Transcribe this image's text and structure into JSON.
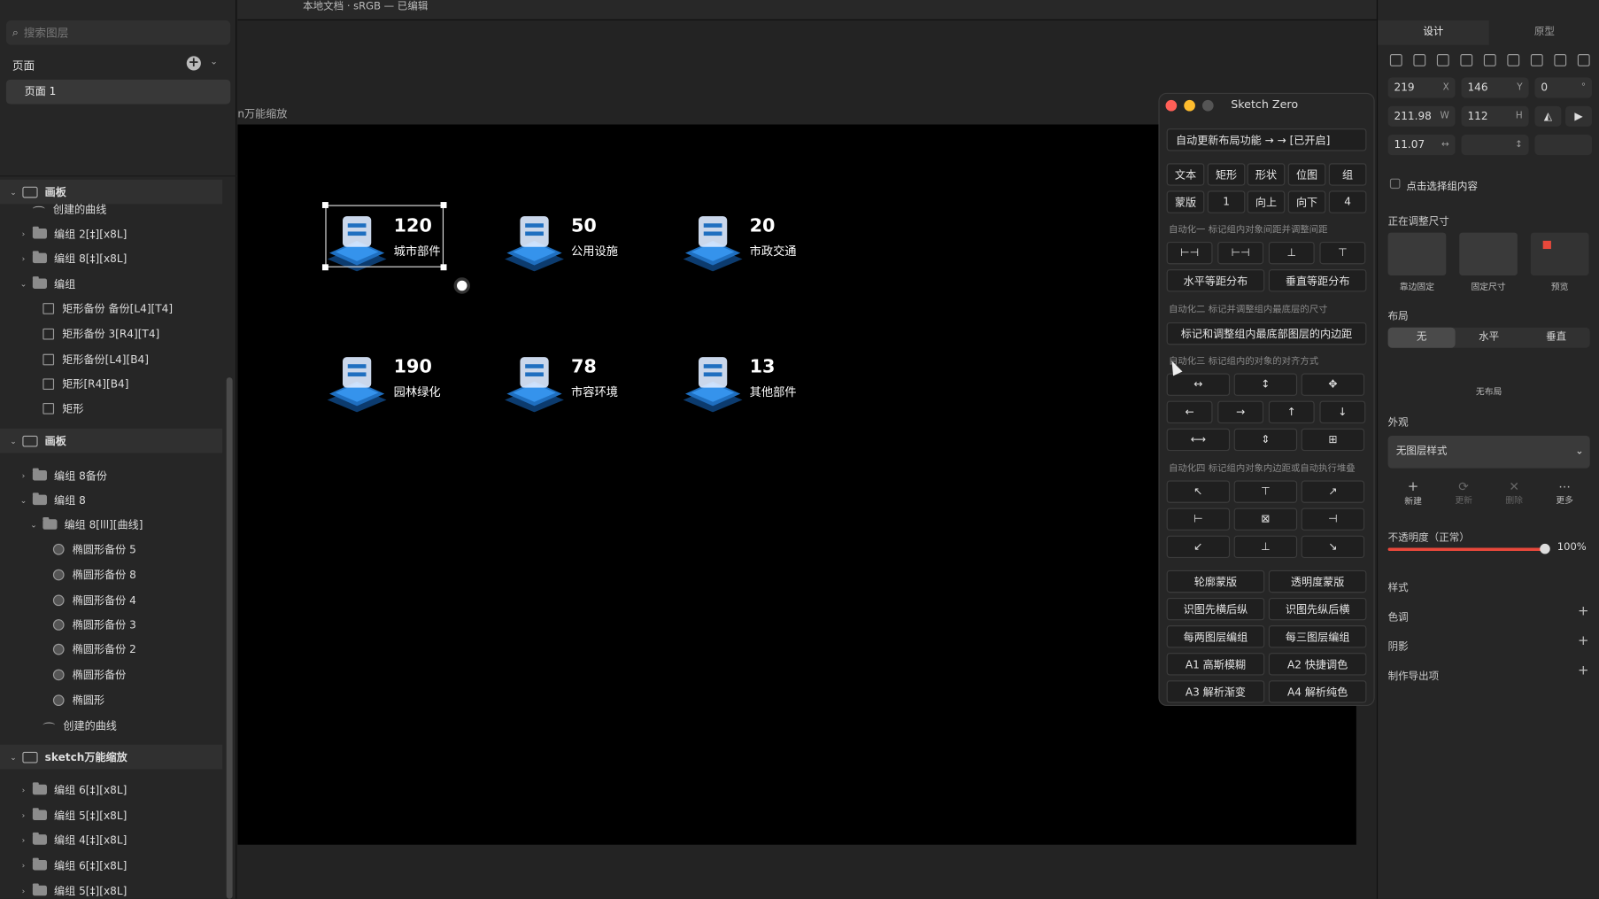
{
  "topbar": {
    "title": "本地文档 · sRGB — 已编辑"
  },
  "left": {
    "search_placeholder": "搜索图层",
    "pages_label": "页面",
    "page_item": "页面 1",
    "layers": [
      {
        "depth": 0,
        "kind": "board",
        "text": "画板",
        "open": true
      },
      {
        "depth": 1,
        "kind": "curve",
        "text": "创建的曲线"
      },
      {
        "depth": 1,
        "kind": "folder",
        "text": "编组 2[‡][x8L]",
        "open": false
      },
      {
        "depth": 1,
        "kind": "folder",
        "text": "编组 8[‡][x8L]",
        "open": false
      },
      {
        "depth": 1,
        "kind": "folder",
        "text": "编组",
        "open": true
      },
      {
        "depth": 2,
        "kind": "rect",
        "text": "矩形备份 备份[L4][T4]"
      },
      {
        "depth": 2,
        "kind": "rect",
        "text": "矩形备份 3[R4][T4]"
      },
      {
        "depth": 2,
        "kind": "rect",
        "text": "矩形备份[L4][B4]"
      },
      {
        "depth": 2,
        "kind": "rect",
        "text": "矩形[R4][B4]"
      },
      {
        "depth": 2,
        "kind": "rect",
        "text": "矩形"
      },
      {
        "depth": 0,
        "kind": "board",
        "text": "画板",
        "open": true
      },
      {
        "depth": 1,
        "kind": "folder",
        "text": "编组 8备份",
        "open": false
      },
      {
        "depth": 1,
        "kind": "folder",
        "text": "编组 8",
        "open": true
      },
      {
        "depth": 2,
        "kind": "folder",
        "text": "编组 8[lll][曲线]",
        "open": true
      },
      {
        "depth": 3,
        "kind": "circle",
        "text": "椭圆形备份 5"
      },
      {
        "depth": 3,
        "kind": "circle",
        "text": "椭圆形备份 8"
      },
      {
        "depth": 3,
        "kind": "circle",
        "text": "椭圆形备份 4"
      },
      {
        "depth": 3,
        "kind": "circle",
        "text": "椭圆形备份 3"
      },
      {
        "depth": 3,
        "kind": "circle",
        "text": "椭圆形备份 2"
      },
      {
        "depth": 3,
        "kind": "circle",
        "text": "椭圆形备份"
      },
      {
        "depth": 3,
        "kind": "circle",
        "text": "椭圆形"
      },
      {
        "depth": 2,
        "kind": "curve",
        "text": "创建的曲线"
      },
      {
        "depth": 0,
        "kind": "board",
        "text": "sketch万能缩放",
        "open": true
      },
      {
        "depth": 1,
        "kind": "folder",
        "text": "编组 6[‡][x8L]",
        "open": false
      },
      {
        "depth": 1,
        "kind": "folder",
        "text": "编组 5[‡][x8L]",
        "open": false
      },
      {
        "depth": 1,
        "kind": "folder",
        "text": "编组 4[‡][x8L]",
        "open": false
      },
      {
        "depth": 1,
        "kind": "folder",
        "text": "编组 6[‡][x8L]",
        "open": false
      },
      {
        "depth": 1,
        "kind": "folder",
        "text": "编组 5[‡][x8L]",
        "open": false
      }
    ]
  },
  "canvas": {
    "artboard_label": "n万能缩放",
    "tiles": [
      {
        "value": "120",
        "label": "城市部件",
        "icon": "typewriter-icon"
      },
      {
        "value": "50",
        "label": "公用设施",
        "icon": "gear-icon"
      },
      {
        "value": "20",
        "label": "市政交通",
        "icon": "traffic-light-icon"
      },
      {
        "value": "190",
        "label": "园林绿化",
        "icon": "tree-icon"
      },
      {
        "value": "78",
        "label": "市容环境",
        "icon": "city-icon"
      },
      {
        "value": "13",
        "label": "其他部件",
        "icon": "wrench-icon"
      }
    ]
  },
  "plugin": {
    "title": "Sketch Zero",
    "auto_update": "自动更新布局功能 → → [已开启]",
    "row1": [
      "文本",
      "矩形",
      "形状",
      "位图",
      "组"
    ],
    "row2": [
      "蒙版",
      "1",
      "向上",
      "向下",
      "4"
    ],
    "sec1": "自动化一 标记组内对象间距并调整间距",
    "dist_h": "水平等距分布",
    "dist_v": "垂直等距分布",
    "sec2": "自动化二 标记并调整组内最底层的尺寸",
    "padding_btn": "标记和调整组内最底部图层的内边距",
    "sec3": "自动化三 标记组内的对象的对齐方式",
    "sec4": "自动化四 标记组内对象内边距或自动执行堆叠",
    "bottom": [
      "轮廓蒙版",
      "透明度蒙版",
      "识图先横后纵",
      "识图先纵后横",
      "每两图层编组",
      "每三图层编组",
      "A1 高斯模糊",
      "A2 快捷调色",
      "A3 解析渐变",
      "A4 解析纯色"
    ]
  },
  "right": {
    "tabs": [
      "设计",
      "原型"
    ],
    "x": "219",
    "y": "146",
    "rot": "0",
    "w": "211.98",
    "h": "112",
    "extra": "11.07",
    "x_u": "X",
    "y_u": "Y",
    "w_u": "W",
    "h_u": "H",
    "click_select": "点击选择组内容",
    "resizing": "正在调整尺寸",
    "resize_opts": [
      "靠边固定",
      "固定尺寸",
      "预览"
    ],
    "layout": "布局",
    "layout_opts": [
      "无",
      "水平",
      "垂直"
    ],
    "no_layout": "无布局",
    "appearance": "外观",
    "no_style": "无图层样式",
    "style_actions": [
      "新建",
      "更新",
      "删除",
      "更多"
    ],
    "opacity_label": "不透明度（正常）",
    "opacity_value": "100%",
    "opacity": 1.0,
    "style": "样式",
    "tint": "色调",
    "shadow": "阴影",
    "export": "制作导出项",
    "accent": "#e8483b"
  }
}
